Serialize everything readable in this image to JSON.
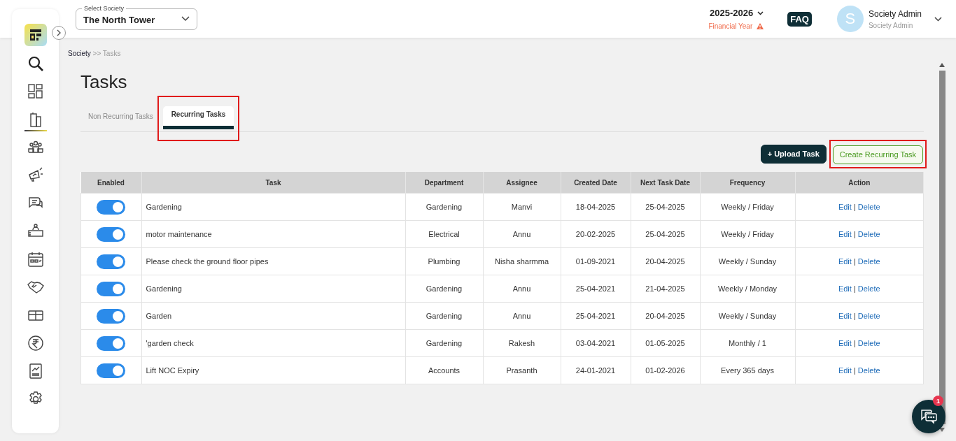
{
  "header": {
    "society_select": {
      "label": "Select Society",
      "value": "The North Tower"
    },
    "financial_year": {
      "value": "2025-2026",
      "label": "Financial Year"
    },
    "faq": "FAQ",
    "user": {
      "initial": "S",
      "name": "Society Admin",
      "role": "Society Admin"
    }
  },
  "sidebar": {
    "items": [
      {
        "selected": false
      },
      {
        "selected": false
      },
      {
        "selected": true
      },
      {
        "selected": false
      },
      {
        "selected": false
      },
      {
        "selected": false
      },
      {
        "selected": false
      },
      {
        "selected": false
      },
      {
        "selected": false
      },
      {
        "selected": false
      },
      {
        "selected": false
      },
      {
        "selected": false
      },
      {
        "selected": false
      }
    ]
  },
  "breadcrumb": {
    "root": "Society",
    "separator": ">>",
    "current": "Tasks"
  },
  "title": "Tasks",
  "tabs": [
    {
      "label": "Non Recurring Tasks",
      "selected": false,
      "highlighted": false
    },
    {
      "label": "Recurring Tasks",
      "selected": true,
      "highlighted": true
    }
  ],
  "buttons": [
    {
      "label": "+ Upload Task",
      "kind": "primary",
      "highlighted": false
    },
    {
      "label": "Create Recurring Task",
      "kind": "outline",
      "highlighted": true
    }
  ],
  "table": {
    "columns": [
      "Enabled",
      "Task",
      "Department",
      "Assignee",
      "Created Date",
      "Next Task Date",
      "Frequency",
      "Action"
    ],
    "rows": [
      {
        "on": true,
        "task": "Gardening",
        "department": "Gardening",
        "assignee": "Manvi",
        "created": "18-04-2025",
        "next": "25-04-2025",
        "frequency": "Weekly / Friday",
        "edit": "Edit",
        "sep": "|",
        "delete": "Delete"
      },
      {
        "on": true,
        "task": "motor maintenance",
        "department": "Electrical",
        "assignee": "Annu",
        "created": "20-02-2025",
        "next": "25-04-2025",
        "frequency": "Weekly / Friday",
        "edit": "Edit",
        "sep": "|",
        "delete": "Delete"
      },
      {
        "on": true,
        "task": "Please check the ground floor pipes",
        "department": "Plumbing",
        "assignee": "Nisha sharmma",
        "created": "01-09-2021",
        "next": "20-04-2025",
        "frequency": "Weekly / Sunday",
        "edit": "Edit",
        "sep": "|",
        "delete": "Delete"
      },
      {
        "on": true,
        "task": "Gardening",
        "department": "Gardening",
        "assignee": "Annu",
        "created": "25-04-2021",
        "next": "21-04-2025",
        "frequency": "Weekly / Monday",
        "edit": "Edit",
        "sep": "|",
        "delete": "Delete"
      },
      {
        "on": true,
        "task": "Garden",
        "department": "Gardening",
        "assignee": "Annu",
        "created": "25-04-2021",
        "next": "20-04-2025",
        "frequency": "Weekly / Sunday",
        "edit": "Edit",
        "sep": "|",
        "delete": "Delete"
      },
      {
        "on": true,
        "task": "'garden check",
        "department": "Gardening",
        "assignee": "Rakesh",
        "created": "03-04-2021",
        "next": "01-05-2025",
        "frequency": "Monthly / 1",
        "edit": "Edit",
        "sep": "|",
        "delete": "Delete"
      },
      {
        "on": true,
        "task": "Lift NOC Expiry",
        "department": "Accounts",
        "assignee": "Prasanth",
        "created": "24-01-2021",
        "next": "01-02-2026",
        "frequency": "Every 365 days",
        "edit": "Edit",
        "sep": "|",
        "delete": "Delete"
      }
    ]
  },
  "chat": {
    "badge": "1"
  }
}
